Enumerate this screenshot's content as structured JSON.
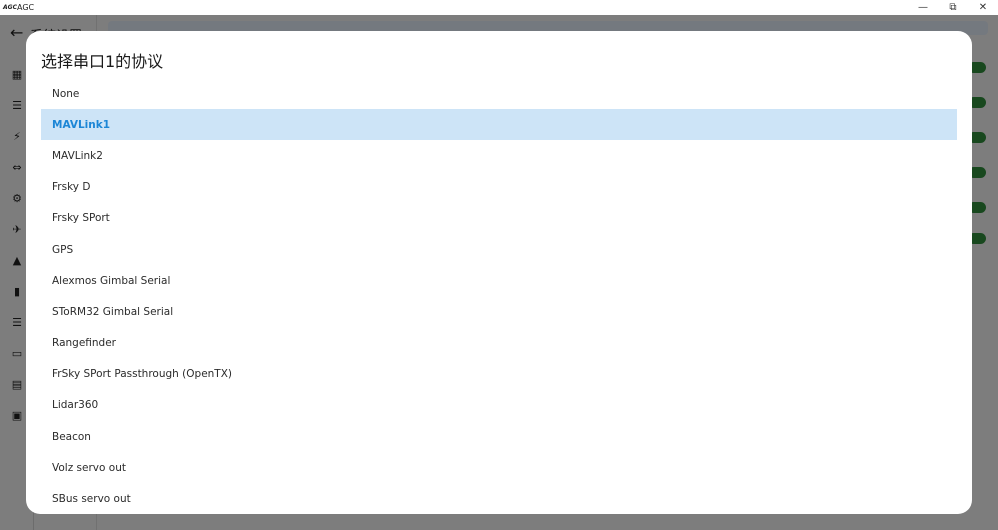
{
  "window": {
    "app_name": "AGC",
    "logo_text": "AGC",
    "minimize": "—",
    "restore": "⧉",
    "close": "✕"
  },
  "app": {
    "header_title": "系统设置",
    "back_icon": "←"
  },
  "dialog": {
    "title": "选择串口1的协议",
    "selected_index": 1,
    "options": [
      "None",
      "MAVLink1",
      "MAVLink2",
      "Frsky D",
      "Frsky SPort",
      "GPS",
      "Alexmos Gimbal Serial",
      "SToRM32 Gimbal Serial",
      "Rangefinder",
      "FrSky SPort Passthrough (OpenTX)",
      "Lidar360",
      "Beacon",
      "Volz servo out",
      "SBus servo out"
    ]
  },
  "colors": {
    "selected_bg": "#cde4f7",
    "selected_text": "#1c86d6",
    "toggle_on": "#2e8b3a"
  }
}
